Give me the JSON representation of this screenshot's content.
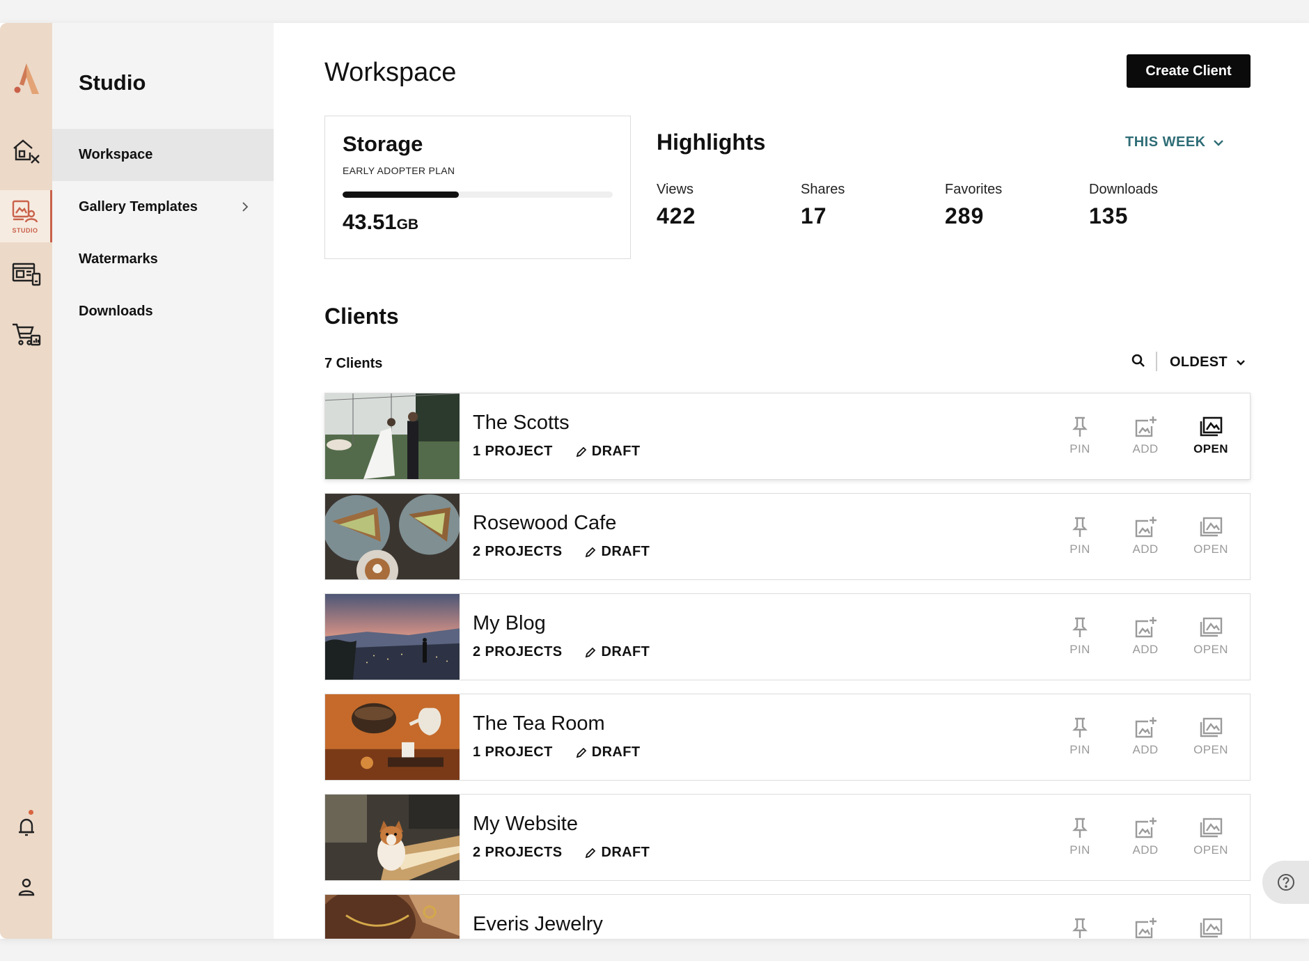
{
  "app": {
    "section_title": "Studio",
    "rail": [
      {
        "icon": "home-edit-icon"
      },
      {
        "icon": "studio-gallery-icon",
        "label": "STUDIO",
        "active": true
      },
      {
        "icon": "website-builder-icon"
      },
      {
        "icon": "store-analytics-icon"
      }
    ],
    "rail_bottom": [
      {
        "icon": "bell-icon"
      },
      {
        "icon": "user-icon"
      }
    ],
    "accent_color": "#c9614a"
  },
  "subnav": {
    "items": [
      {
        "label": "Workspace",
        "active": true
      },
      {
        "label": "Gallery Templates",
        "has_chevron": true
      },
      {
        "label": "Watermarks"
      },
      {
        "label": "Downloads"
      }
    ]
  },
  "header": {
    "title": "Workspace",
    "create_label": "Create Client"
  },
  "storage": {
    "title": "Storage",
    "plan": "EARLY ADOPTER PLAN",
    "amount": "43.51",
    "unit": "GB",
    "usage_fraction": 0.43
  },
  "highlights": {
    "title": "Highlights",
    "period": "THIS WEEK",
    "stats": [
      {
        "label": "Views",
        "value": "422"
      },
      {
        "label": "Shares",
        "value": "17"
      },
      {
        "label": "Favorites",
        "value": "289"
      },
      {
        "label": "Downloads",
        "value": "135"
      }
    ]
  },
  "clients": {
    "title": "Clients",
    "count": "7 Clients",
    "sort": "OLDEST",
    "actions": {
      "pin": "PIN",
      "add": "ADD",
      "open": "OPEN"
    },
    "draft_label": "DRAFT",
    "rows": [
      {
        "name": "The Scotts",
        "projects": "1 PROJECT",
        "thumb": "wedding-photo"
      },
      {
        "name": "Rosewood Cafe",
        "projects": "2 PROJECTS",
        "thumb": "cafe-food-photo"
      },
      {
        "name": "My Blog",
        "projects": "2 PROJECTS",
        "thumb": "sunset-city-photo"
      },
      {
        "name": "The Tea Room",
        "projects": "1 PROJECT",
        "thumb": "tea-set-photo"
      },
      {
        "name": "My Website",
        "projects": "2 PROJECTS",
        "thumb": "corgi-dog-photo"
      },
      {
        "name": "Everis Jewelry",
        "projects": "",
        "thumb": "jewelry-photo"
      }
    ]
  }
}
